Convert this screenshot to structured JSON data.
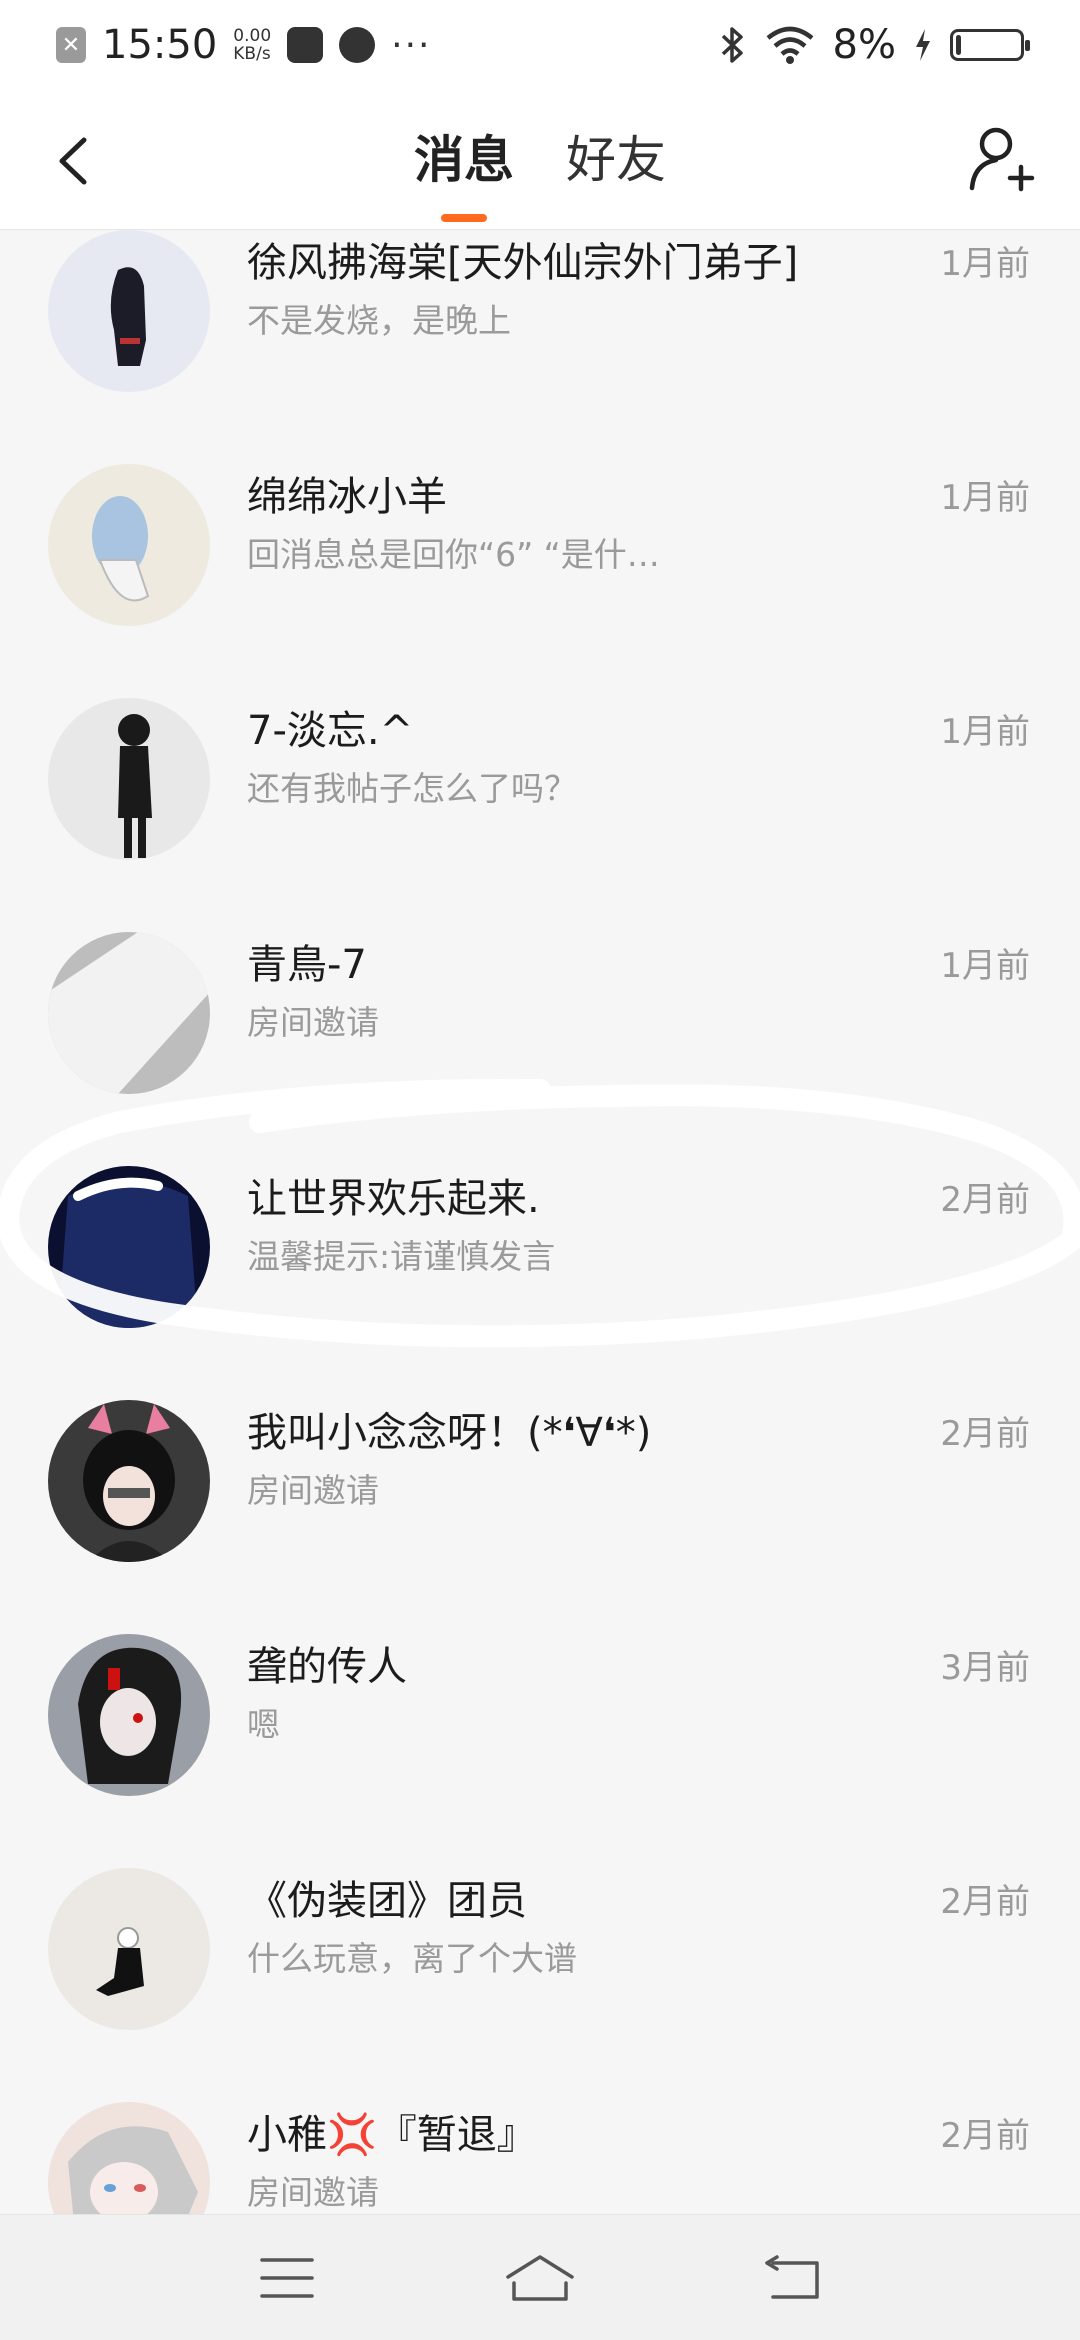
{
  "status_bar": {
    "time": "15:50",
    "speed_value": "0.00",
    "speed_unit": "KB/s",
    "battery_percent": "8%",
    "battery_level": 0.08,
    "overflow": "···"
  },
  "header": {
    "tabs": [
      {
        "label": "消息",
        "active": true
      },
      {
        "label": "好友",
        "active": false
      }
    ],
    "accent_color": "#ff6a1f"
  },
  "conversations": [
    {
      "name": "徐风拂海棠[天外仙宗外门弟子]",
      "preview": "不是发烧，是晚上",
      "time": "1月前",
      "avatar_colors": [
        "#e7e9f2",
        "#1c1c28"
      ]
    },
    {
      "name": "绵绵冰小羊",
      "preview": "回消息总是回你“6”               “是什…",
      "time": "1月前",
      "avatar_colors": [
        "#eeeae0",
        "#a8c4e0"
      ]
    },
    {
      "name": "7-淡忘.^",
      "preview": "还有我帖子怎么了吗？",
      "time": "1月前",
      "avatar_colors": [
        "#e8e8e8",
        "#1a1a1a"
      ]
    },
    {
      "name": "青鳥-7",
      "preview": "房间邀请",
      "time": "1月前",
      "avatar_colors": [
        "#bdbdbd",
        "#f2f2f2"
      ]
    },
    {
      "name": "让世界欢乐起来.",
      "preview": "温馨提示:请谨慎发言",
      "time": "2月前",
      "avatar_colors": [
        "#0b1030",
        "#1c2a66"
      ]
    },
    {
      "name": "我叫小念念呀！(*❛∀❛*)",
      "preview": "房间邀请",
      "time": "2月前",
      "avatar_colors": [
        "#3a3a3a",
        "#e87fa0"
      ]
    },
    {
      "name": "聋的传人",
      "preview": "嗯",
      "time": "3月前",
      "avatar_colors": [
        "#9a9ea6",
        "#1b1b1b"
      ]
    },
    {
      "name": "《伪装团》团员",
      "preview": "什么玩意，离了个大谱",
      "time": "2月前",
      "avatar_colors": [
        "#ece9e4",
        "#111111"
      ]
    },
    {
      "name": "小稚💢『暂退』",
      "preview": "房间邀请",
      "time": "2月前",
      "avatar_colors": [
        "#f0e2dc",
        "#c9c9c9"
      ]
    }
  ],
  "icons": {
    "back": "chevron-left-icon",
    "add_friend": "add-user-icon",
    "nav": [
      "menu-icon",
      "home-icon",
      "back-arrow-icon"
    ]
  }
}
